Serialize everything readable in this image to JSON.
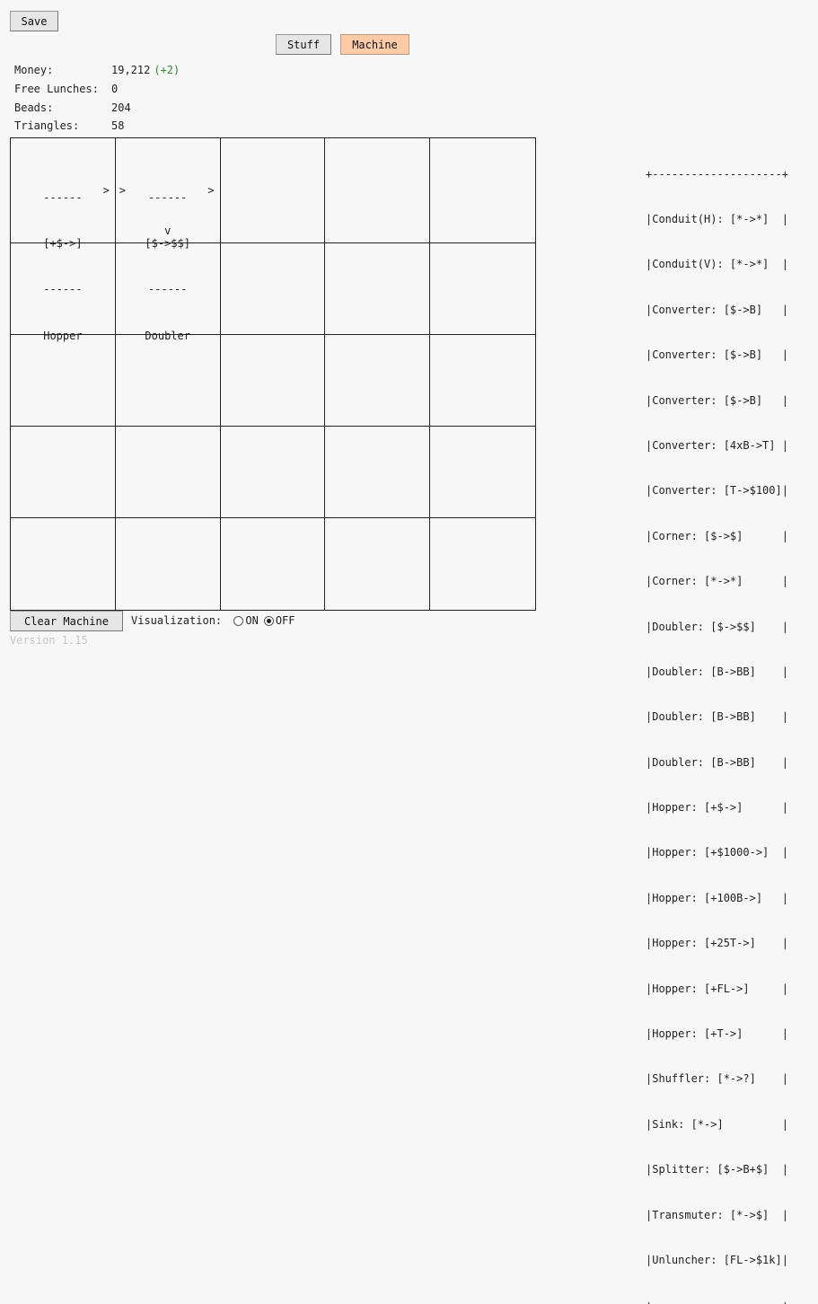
{
  "toolbar": {
    "save_label": "Save"
  },
  "tabs": [
    {
      "label": "Stuff",
      "active": false
    },
    {
      "label": "Machine",
      "active": true
    }
  ],
  "stats": {
    "money_label": "Money:",
    "money_value": "19,212",
    "money_delta": "(+2)",
    "lunches_label": "Free Lunches:",
    "lunches_value": "0",
    "beads_label": "Beads:",
    "beads_value": "204",
    "triangles_label": "Triangles:",
    "triangles_value": "58"
  },
  "grid": {
    "tiles": {
      "hopper": {
        "top": "------",
        "code": "[+$->]",
        "bottom": "------",
        "name": "Hopper",
        "out_arrow": ">"
      },
      "doubler": {
        "top": "------",
        "code": "[$->$$]",
        "bottom": "------",
        "name": "Doubler",
        "in_arrow": ">",
        "out_arrow": ">",
        "down_arrow": "v"
      }
    }
  },
  "parts_list": {
    "border": "+--------------------+",
    "rows": [
      "|Conduit(H): [*->*]  |",
      "|Conduit(V): [*->*]  |",
      "|Converter: [$->B]   |",
      "|Converter: [$->B]   |",
      "|Converter: [$->B]   |",
      "|Converter: [4xB->T] |",
      "|Converter: [T->$100]|",
      "|Corner: [$->$]      |",
      "|Corner: [*->*]      |",
      "|Doubler: [$->$$]    |",
      "|Doubler: [B->BB]    |",
      "|Doubler: [B->BB]    |",
      "|Doubler: [B->BB]    |",
      "|Hopper: [+$->]      |",
      "|Hopper: [+$1000->]  |",
      "|Hopper: [+100B->]   |",
      "|Hopper: [+25T->]    |",
      "|Hopper: [+FL->]     |",
      "|Hopper: [+T->]      |",
      "|Shuffler: [*->?]    |",
      "|Sink: [*->]         |",
      "|Splitter: [$->B+$]  |",
      "|Transmuter: [*->$]  |",
      "|Unluncher: [FL->$1k]|"
    ]
  },
  "footer": {
    "clear_label": "Clear Machine",
    "viz_label": "Visualization: ",
    "on_label": "ON",
    "off_label": "OFF",
    "viz_selected": "OFF",
    "version": "Version 1.15"
  },
  "colors": {
    "active_tab": "#fdcba8",
    "delta_green": "#2e8b2e",
    "background": "#f7f7f7"
  }
}
